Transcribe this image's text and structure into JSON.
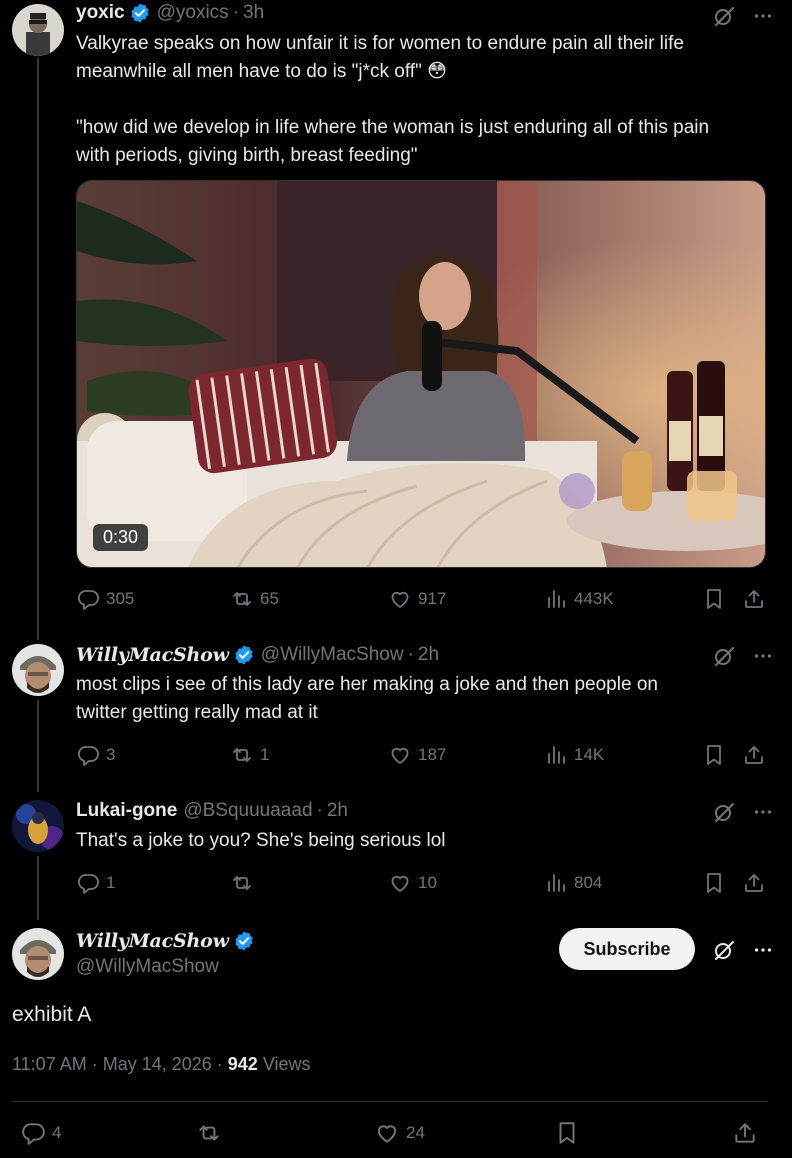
{
  "thread": [
    {
      "display_name": "yoxic",
      "handle": "@yoxics",
      "time": "3h",
      "verified": true,
      "text_lines": [
        "Valkyrae speaks on how unfair it is for women to endure pain all their life",
        "meanwhile all men have to do is \"j*ck off\" 😳",
        "",
        "\"how did we develop in life where the woman is just enduring all of this pain",
        "with periods, giving birth, breast feeding\""
      ],
      "video_duration": "0:30",
      "replies": "305",
      "reposts": "65",
      "likes": "917",
      "views": "443K"
    },
    {
      "display_name": "WillyMacShow",
      "handle": "@WillyMacShow",
      "time": "2h",
      "verified": true,
      "text_lines": [
        "most clips i see of this lady are her making a joke and then people on",
        "twitter getting really mad at it"
      ],
      "replies": "3",
      "reposts": "1",
      "likes": "187",
      "views": "14K"
    },
    {
      "display_name": "Lukai-gone",
      "handle": "@BSquuuaaad",
      "time": "2h",
      "verified": false,
      "text_lines": [
        "That's a joke to you? She's being serious lol"
      ],
      "replies": "1",
      "reposts": "",
      "likes": "10",
      "views": "804"
    }
  ],
  "main_post": {
    "display_name": "WillyMacShow",
    "handle": "@WillyMacShow",
    "verified": true,
    "subscribe_label": "Subscribe",
    "text": "exhibit A",
    "timestamp": "11:07 AM · May 14, 2026 ·",
    "views_count": "942",
    "views_label": "Views",
    "replies": "4",
    "reposts": "",
    "likes": "24"
  },
  "colors": {
    "background": "#000000",
    "text": "#e7e9ea",
    "muted": "#71767b",
    "verified_blue": "#1d9bf0",
    "subscribe_bg": "#eff3f4"
  },
  "icons": {
    "reply": "speech-bubble-icon",
    "repost": "repost-arrows-icon",
    "like": "heart-icon",
    "views": "bar-chart-icon",
    "bookmark": "bookmark-icon",
    "share": "share-upload-icon",
    "grok": "grok-slash-circle-icon",
    "more": "ellipsis-icon",
    "verified": "verified-badge-icon"
  }
}
